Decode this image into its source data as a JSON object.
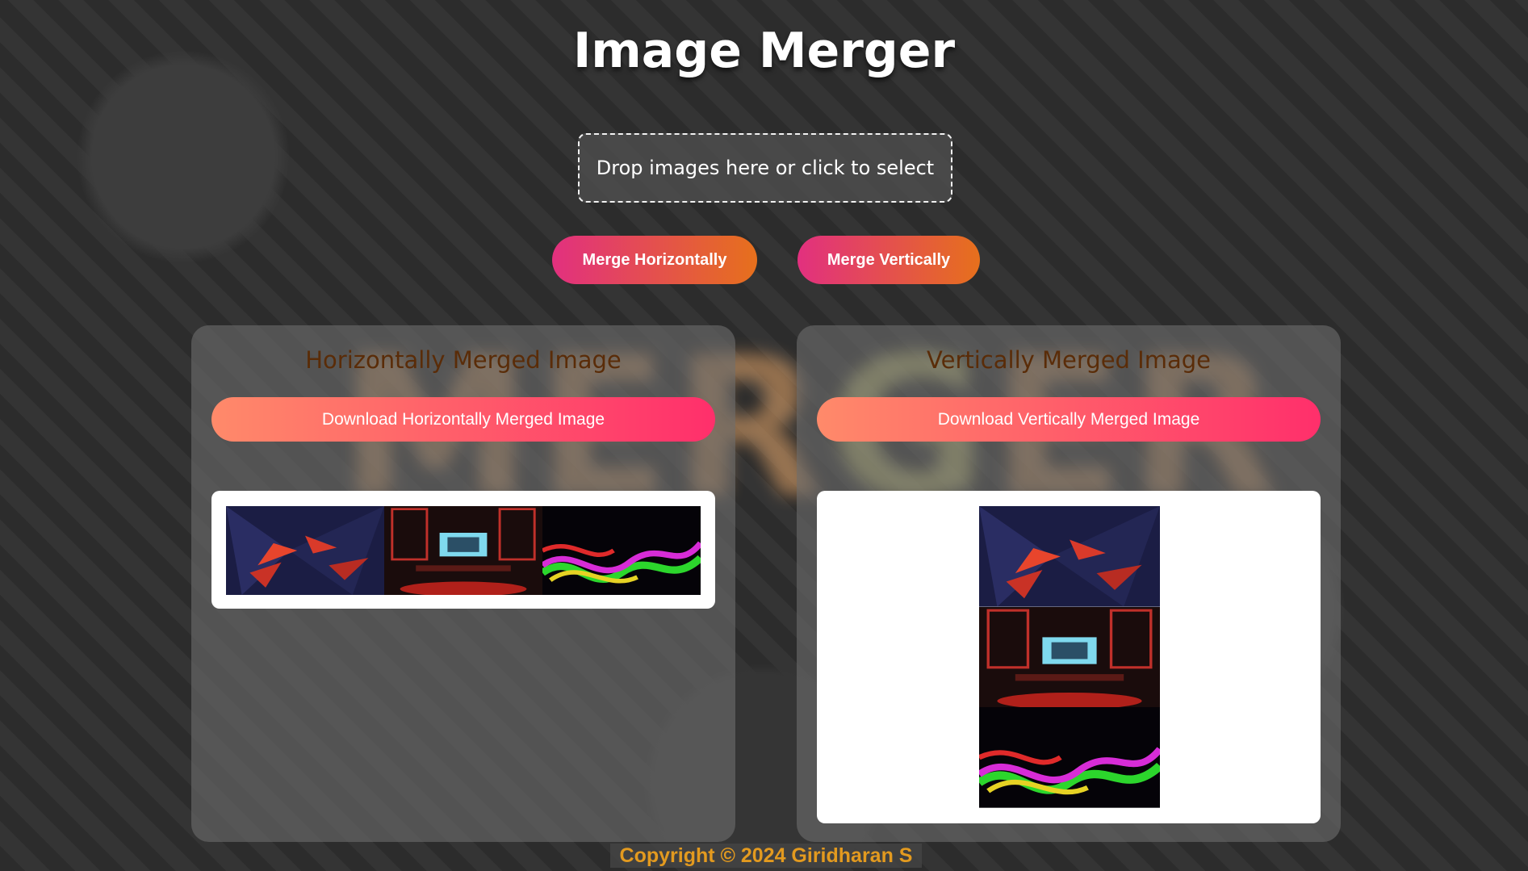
{
  "app": {
    "title": "Image Merger",
    "background_word": "MERGER"
  },
  "dropzone": {
    "text": "Drop images here or click to select"
  },
  "actions": {
    "merge_horizontal": "Merge Horizontally",
    "merge_vertical": "Merge Vertically"
  },
  "panels": {
    "horizontal": {
      "title": "Horizontally Merged Image",
      "download": "Download Horizontally Merged Image"
    },
    "vertical": {
      "title": "Vertically Merged Image",
      "download": "Download Vertically Merged Image"
    }
  },
  "images": [
    "abstract-shards",
    "gaming-room",
    "neon-smoke"
  ],
  "footer": {
    "text": "Copyright © 2024 Giridharan S"
  },
  "colors": {
    "merge_gradient": [
      "#e2307f",
      "#e6701c"
    ],
    "download_gradient": [
      "#ff8a6a",
      "#ff2f6b"
    ],
    "panel_title": "#5a2c08",
    "footer_text": "#e39a1f"
  }
}
